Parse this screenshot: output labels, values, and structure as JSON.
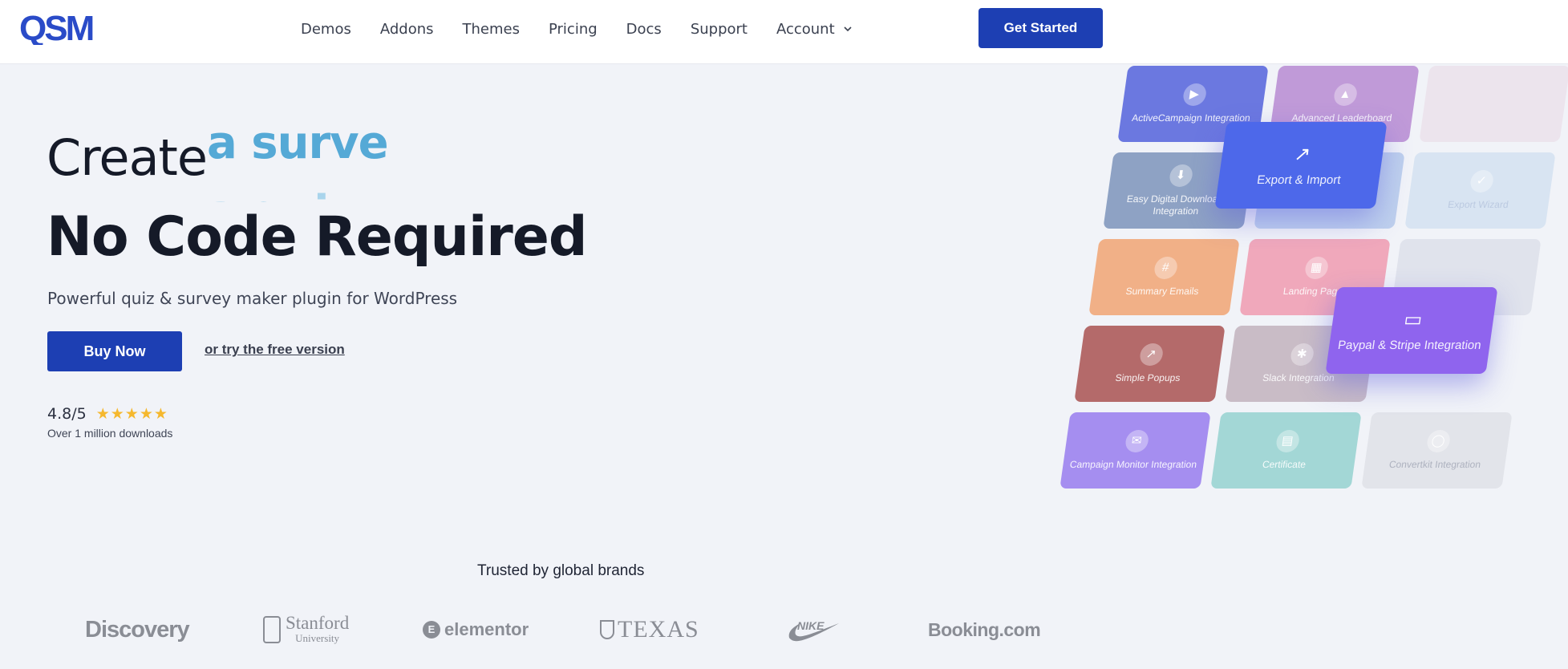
{
  "header": {
    "logo_text": "QSM",
    "nav": [
      {
        "label": "Demos"
      },
      {
        "label": "Addons"
      },
      {
        "label": "Themes"
      },
      {
        "label": "Pricing"
      },
      {
        "label": "Docs"
      },
      {
        "label": "Support"
      },
      {
        "label": "Account"
      }
    ],
    "cta_label": "Get Started"
  },
  "hero": {
    "create_word": "Create",
    "rotating_word_1": "a surve",
    "rotating_word_2": "a quiz",
    "headline": "No Code Required",
    "subtitle": "Powerful quiz & survey maker plugin for WordPress",
    "buy_label": "Buy Now",
    "free_link_label": "or try the free version",
    "rating": "4.8/5",
    "stars": "★★★★★",
    "downloads": "Over 1 million downloads"
  },
  "tiles": [
    {
      "label": "ActiveCampaign Integration",
      "icon": "▶",
      "color": "#6b78e0"
    },
    {
      "label": "Advanced Leaderboard",
      "icon": "▲",
      "color": "#c09ad8"
    },
    {
      "label": "",
      "icon": "",
      "color": "#eadbe6"
    },
    {
      "label": "Easy Digital Downloads Integration",
      "icon": "⬇",
      "color": "#8ea2c4"
    },
    {
      "label": "",
      "icon": "",
      "color": "#a8c0e8"
    },
    {
      "label": "Export Wizard",
      "icon": "✓",
      "color": "#d8e4f2"
    },
    {
      "label": "Summary Emails",
      "icon": "#",
      "color": "#f1b087"
    },
    {
      "label": "Landing Page",
      "icon": "▦",
      "color": "#f0a8bb"
    },
    {
      "label": "",
      "icon": "",
      "color": "#dcdfe8"
    },
    {
      "label": "Simple Popups",
      "icon": "↗",
      "color": "#b46a6a"
    },
    {
      "label": "Slack Integration",
      "icon": "✱",
      "color": "#c9bcc6"
    },
    {
      "label": "Campaign Monitor Integration",
      "icon": "✉",
      "color": "#a58ef0"
    },
    {
      "label": "Certificate",
      "icon": "▤",
      "color": "#a3d7d6"
    },
    {
      "label": "Convertkit Integration",
      "icon": "◯",
      "color": "#e2e4ea"
    },
    {
      "label": "Export & Import",
      "icon": "↗",
      "color": "#4d68ea"
    },
    {
      "label": "Paypal & Stripe Integration",
      "icon": "▭",
      "color": "#8f64ee"
    }
  ],
  "brands": {
    "trusted_title": "Trusted by global brands",
    "discovery": "Discovery",
    "stanford_name": "Stanford",
    "stanford_uni": "University",
    "elementor_mark": "E",
    "elementor": "elementor",
    "texas": "TEXAS",
    "nike": "NIKE",
    "booking": "Booking.com"
  },
  "colors": {
    "primary": "#1d3fb3",
    "accent_text": "#55a9d6",
    "star": "#f5b82e",
    "background": "#f1f3f8"
  }
}
